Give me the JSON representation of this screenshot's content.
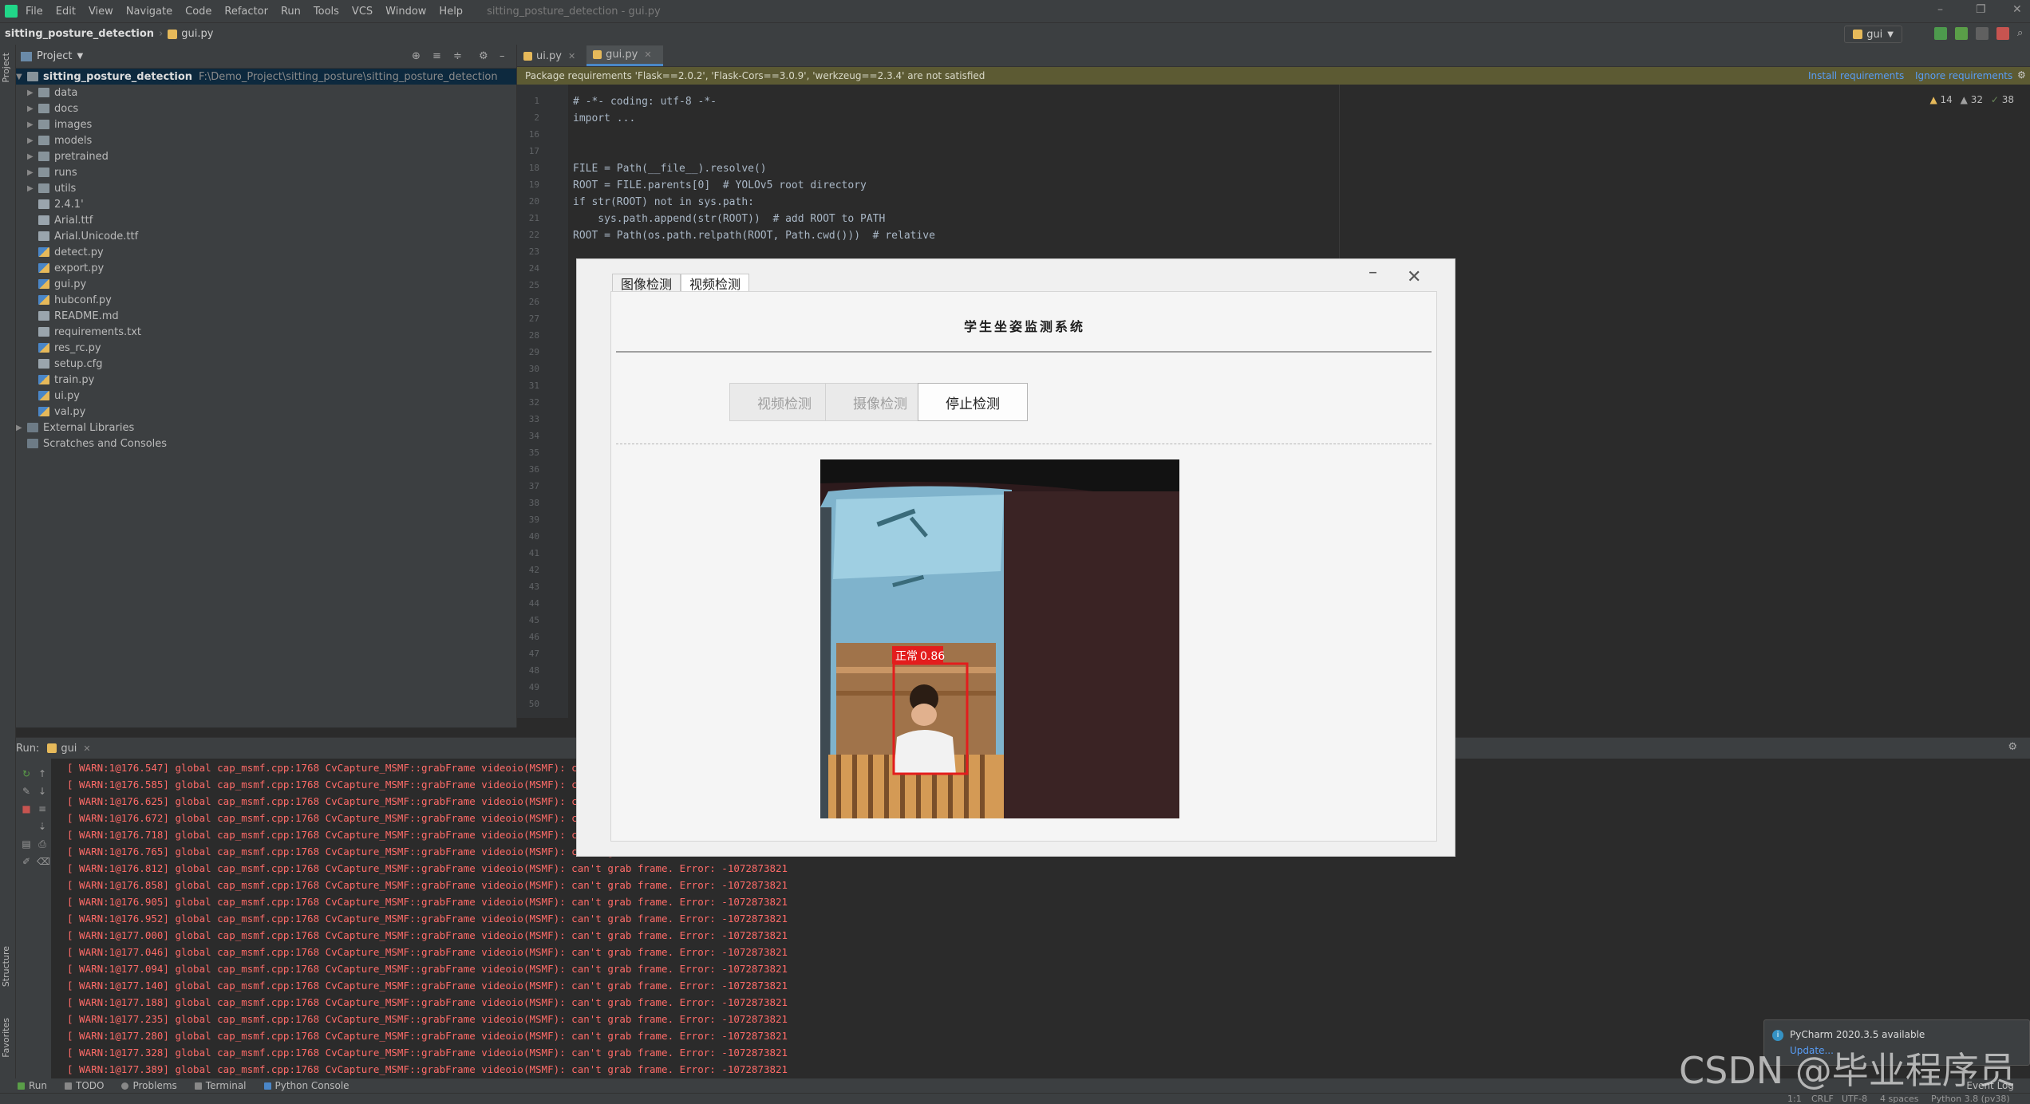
{
  "menu": {
    "items": [
      "File",
      "Edit",
      "View",
      "Navigate",
      "Code",
      "Refactor",
      "Run",
      "Tools",
      "VCS",
      "Window",
      "Help"
    ],
    "window_title": "sitting_posture_detection - gui.py"
  },
  "nav": {
    "project": "sitting_posture_detection",
    "file": "gui.py",
    "run_config": "gui"
  },
  "project_panel": {
    "title": "Project",
    "root": "sitting_posture_detection",
    "root_path": "F:\\Demo_Project\\sitting_posture\\sitting_posture_detection",
    "folders": [
      "data",
      "docs",
      "images",
      "models",
      "pretrained",
      "runs",
      "utils"
    ],
    "files": [
      {
        "name": "2.4.1'",
        "kind": "file"
      },
      {
        "name": "Arial.ttf",
        "kind": "file"
      },
      {
        "name": "Arial.Unicode.ttf",
        "kind": "file"
      },
      {
        "name": "detect.py",
        "kind": "py"
      },
      {
        "name": "export.py",
        "kind": "py"
      },
      {
        "name": "gui.py",
        "kind": "py"
      },
      {
        "name": "hubconf.py",
        "kind": "py"
      },
      {
        "name": "README.md",
        "kind": "file"
      },
      {
        "name": "requirements.txt",
        "kind": "file"
      },
      {
        "name": "res_rc.py",
        "kind": "py"
      },
      {
        "name": "setup.cfg",
        "kind": "file"
      },
      {
        "name": "train.py",
        "kind": "py"
      },
      {
        "name": "ui.py",
        "kind": "py"
      },
      {
        "name": "val.py",
        "kind": "py"
      }
    ],
    "external": "External Libraries",
    "scratches": "Scratches and Consoles"
  },
  "editor": {
    "tabs": [
      {
        "label": "ui.py",
        "active": false
      },
      {
        "label": "gui.py",
        "active": true
      }
    ],
    "banner": "Package requirements 'Flask==2.0.2', 'Flask-Cors==3.0.9', 'werkzeug==2.3.4' are not satisfied",
    "banner_install": "Install requirements",
    "banner_ignore": "Ignore requirements",
    "inspections": {
      "warn1": "14",
      "warn2": "32",
      "ok": "38"
    },
    "line_numbers": [
      "1",
      "2",
      "16",
      "17",
      "18",
      "19",
      "20",
      "21",
      "22",
      "23",
      "24",
      "25",
      "26",
      "27",
      "28",
      "29",
      "30",
      "31",
      "32",
      "33",
      "34",
      "35",
      "36",
      "37",
      "38",
      "39",
      "40",
      "41",
      "42",
      "43",
      "44",
      "45",
      "46",
      "47",
      "48",
      "49",
      "50"
    ],
    "lines": [
      "# -*- coding: utf-8 -*-",
      "import ...",
      "",
      "",
      "FILE = Path(__file__).resolve()",
      "ROOT = FILE.parents[0]  # YOLOv5 root directory",
      "if str(ROOT) not in sys.path:",
      "    sys.path.append(str(ROOT))  # add ROOT to PATH",
      "ROOT = Path(os.path.relpath(ROOT, Path.cwd()))  # relative"
    ]
  },
  "run_panel": {
    "label": "Run:",
    "tab": "gui",
    "log_prefix": "[ WARN:1@",
    "log_suffix": "] global cap_msmf.cpp:1768 CvCapture_MSMF::grabFrame videoio(MSMF): can't grab frame. Error: -1072873821",
    "log_times": [
      "176.547",
      "176.585",
      "176.625",
      "176.672",
      "176.718",
      "176.765",
      "176.812",
      "176.858",
      "176.905",
      "176.952",
      "177.000",
      "177.046",
      "177.094",
      "177.140",
      "177.188",
      "177.235",
      "177.280",
      "177.328",
      "177.389"
    ]
  },
  "bottom_tabs": [
    "Run",
    "TODO",
    "Problems",
    "Terminal",
    "Python Console"
  ],
  "status": {
    "pos": "1:1",
    "crlf": "CRLF",
    "enc": "UTF-8",
    "indent": "4 spaces",
    "interp": "Python 3.8 (pv38)",
    "event_log": "Event Log"
  },
  "notification": {
    "title": "PyCharm 2020.3.5 available",
    "link": "Update..."
  },
  "watermark": "CSDN @毕业程序员",
  "app": {
    "tabs": [
      {
        "label": "图像检测",
        "active": false
      },
      {
        "label": "视频检测",
        "active": true
      }
    ],
    "title": "学生坐姿监测系统",
    "buttons": [
      {
        "label": "视频检测",
        "enabled": false
      },
      {
        "label": "摄像检测",
        "enabled": false
      },
      {
        "label": "停止检测",
        "enabled": true
      }
    ],
    "detection": {
      "label": "正常",
      "score": "0.86"
    }
  },
  "colors": {
    "log_red": "#ff6b68",
    "selection": "#0d293e",
    "banner": "#5c5a33",
    "box": "#e31d1d"
  }
}
